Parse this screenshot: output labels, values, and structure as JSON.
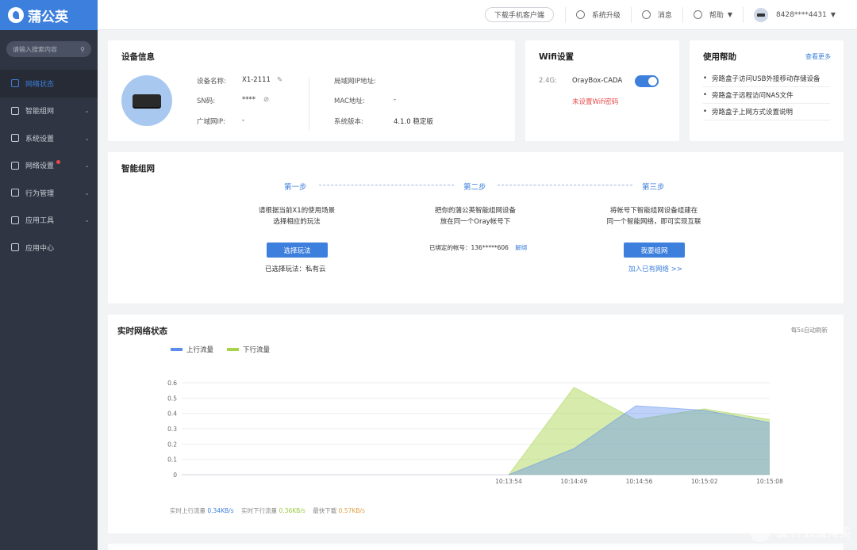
{
  "brand": {
    "name": "蒲公英",
    "accent": "#3c7fdc"
  },
  "sidebar": {
    "search_placeholder": "请输入搜索内容",
    "items": [
      {
        "label": "网络状态",
        "active": true
      },
      {
        "label": "智能组网"
      },
      {
        "label": "系统设置"
      },
      {
        "label": "网络设置",
        "badge": true
      },
      {
        "label": "行为管理"
      },
      {
        "label": "应用工具"
      },
      {
        "label": "应用中心"
      }
    ]
  },
  "topbar": {
    "download": "下载手机客户端",
    "upgrade": "系统升级",
    "messages": "消息",
    "help": "帮助",
    "account": "8428****4431"
  },
  "device": {
    "title": "设备信息",
    "name_label": "设备名称:",
    "name_value": "X1-2111",
    "sn_label": "SN码:",
    "sn_value": "****",
    "wan_label": "广域网IP:",
    "wan_value": "-",
    "lan_label": "局域网IP地址:",
    "lan_value": "",
    "mac_label": "MAC地址:",
    "mac_value": "-",
    "ver_label": "系统版本:",
    "ver_value": "4.1.0 稳定版"
  },
  "wifi": {
    "title": "Wifi设置",
    "band": "2.4G:",
    "ssid": "OrayBox-CADA",
    "enabled": true,
    "warning": "未设置Wifi密码"
  },
  "help": {
    "title": "使用帮助",
    "more": "查看更多",
    "items": [
      "旁路盒子访问USB外接移动存储设备",
      "旁路盒子远程访问NAS文件",
      "旁路盒子上网方式设置说明"
    ]
  },
  "smart": {
    "title": "智能组网",
    "step1": "第一步",
    "step2": "第二步",
    "step3": "第三步",
    "s1_line1": "请根据当前X1的使用场景",
    "s1_line2": "选择相应的玩法",
    "s1_btn": "选择玩法",
    "s1_note": "已选择玩法：私有云",
    "s2_line1": "把你的蒲公英智能组网设备",
    "s2_line2": "放在同一个Oray帐号下",
    "s2_note": "已绑定的帐号：136*****606",
    "s2_unbind": "解绑",
    "s3_line1": "将帐号下智能组网设备组建在",
    "s3_line2": "同一个智能网络，即可实现互联",
    "s3_btn": "我要组网",
    "s3_link": "加入已有网络 >>"
  },
  "traffic": {
    "title": "实时网络状态",
    "auto_refresh": "每5s自动刷新",
    "up_label": "实时上行流量",
    "up_value": "0.34KB/s",
    "down_label": "实时下行流量",
    "down_value": "0.36KB/s",
    "max_label": "最快下载",
    "max_value": "0.57KB/s"
  },
  "chart_data": {
    "type": "area",
    "x": [
      "10:13:54",
      "10:14:49",
      "10:14:56",
      "10:15:02",
      "10:15:08"
    ],
    "ylim": [
      0,
      0.6
    ],
    "yticks": [
      0,
      0.1,
      0.2,
      0.3,
      0.4,
      0.5,
      0.6
    ],
    "series": [
      {
        "name": "上行流量",
        "color": "#5b8def",
        "points": [
          [
            0,
            0
          ],
          [
            1,
            0.17
          ],
          [
            1.95,
            0.45
          ],
          [
            3,
            0.42
          ],
          [
            4,
            0.34
          ]
        ]
      },
      {
        "name": "下行流量",
        "color": "#a6d34a",
        "points": [
          [
            0,
            0
          ],
          [
            1,
            0.57
          ],
          [
            1.95,
            0.36
          ],
          [
            3,
            0.43
          ],
          [
            4,
            0.36
          ]
        ]
      }
    ],
    "grid": true,
    "legend_position": "top-left"
  },
  "watermark": "值 什么值得买"
}
